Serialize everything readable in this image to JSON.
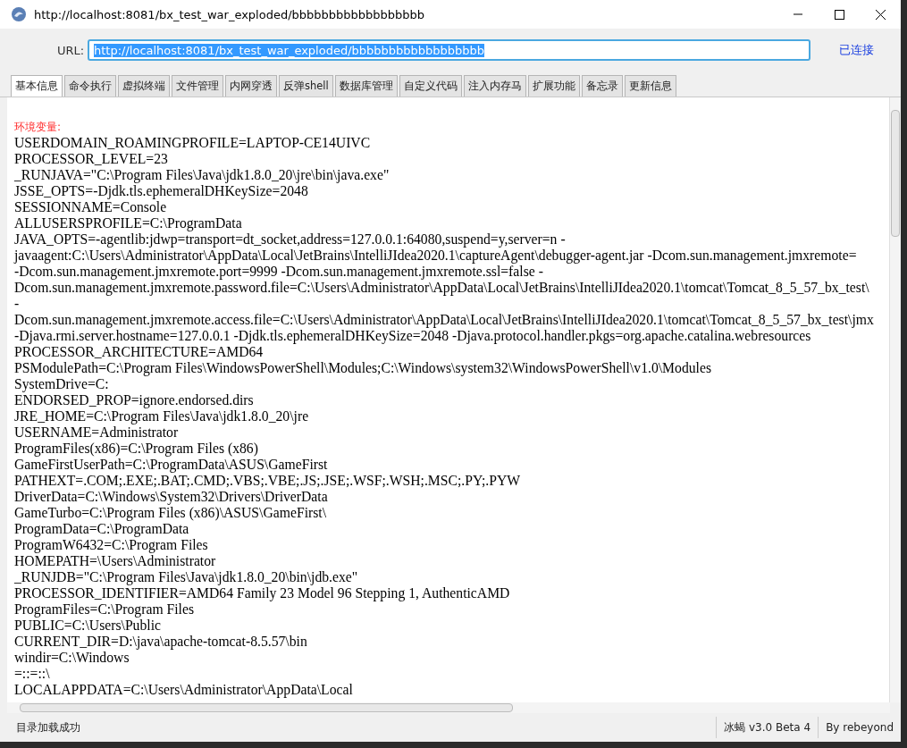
{
  "window": {
    "title": "http://localhost:8081/bx_test_war_exploded/bbbbbbbbbbbbbbbbbb"
  },
  "url_bar": {
    "label": "URL:",
    "value": "http://localhost:8081/bx_test_war_exploded/bbbbbbbbbbbbbbbbbb",
    "text_selected": true,
    "status": "已连接"
  },
  "tabs": [
    {
      "label": "基本信息",
      "selected": true
    },
    {
      "label": "命令执行",
      "selected": false
    },
    {
      "label": "虚拟终端",
      "selected": false
    },
    {
      "label": "文件管理",
      "selected": false
    },
    {
      "label": "内网穿透",
      "selected": false
    },
    {
      "label": "反弹shell",
      "selected": false
    },
    {
      "label": "数据库管理",
      "selected": false
    },
    {
      "label": "自定义代码",
      "selected": false
    },
    {
      "label": "注入内存马",
      "selected": false
    },
    {
      "label": "扩展功能",
      "selected": false
    },
    {
      "label": "备忘录",
      "selected": false
    },
    {
      "label": "更新信息",
      "selected": false
    }
  ],
  "content": {
    "heading": "环境变量:",
    "lines": [
      "USERDOMAIN_ROAMINGPROFILE=LAPTOP-CE14UIVC",
      "PROCESSOR_LEVEL=23",
      "_RUNJAVA=\"C:\\Program Files\\Java\\jdk1.8.0_20\\jre\\bin\\java.exe\"",
      "JSSE_OPTS=-Djdk.tls.ephemeralDHKeySize=2048",
      "SESSIONNAME=Console",
      "ALLUSERSPROFILE=C:\\ProgramData",
      "JAVA_OPTS=-agentlib:jdwp=transport=dt_socket,address=127.0.0.1:64080,suspend=y,server=n -",
      "javaagent:C:\\Users\\Administrator\\AppData\\Local\\JetBrains\\IntelliJIdea2020.1\\captureAgent\\debugger-agent.jar -Dcom.sun.management.jmxremote=",
      "-Dcom.sun.management.jmxremote.port=9999 -Dcom.sun.management.jmxremote.ssl=false -",
      "Dcom.sun.management.jmxremote.password.file=C:\\Users\\Administrator\\AppData\\Local\\JetBrains\\IntelliJIdea2020.1\\tomcat\\Tomcat_8_5_57_bx_test\\",
      "-",
      "Dcom.sun.management.jmxremote.access.file=C:\\Users\\Administrator\\AppData\\Local\\JetBrains\\IntelliJIdea2020.1\\tomcat\\Tomcat_8_5_57_bx_test\\jmx",
      "-Djava.rmi.server.hostname=127.0.0.1 -Djdk.tls.ephemeralDHKeySize=2048 -Djava.protocol.handler.pkgs=org.apache.catalina.webresources",
      "PROCESSOR_ARCHITECTURE=AMD64",
      "PSModulePath=C:\\Program Files\\WindowsPowerShell\\Modules;C:\\Windows\\system32\\WindowsPowerShell\\v1.0\\Modules",
      "SystemDrive=C:",
      "ENDORSED_PROP=ignore.endorsed.dirs",
      "JRE_HOME=C:\\Program Files\\Java\\jdk1.8.0_20\\jre",
      "USERNAME=Administrator",
      "ProgramFiles(x86)=C:\\Program Files (x86)",
      "GameFirstUserPath=C:\\ProgramData\\ASUS\\GameFirst",
      "PATHEXT=.COM;.EXE;.BAT;.CMD;.VBS;.VBE;.JS;.JSE;.WSF;.WSH;.MSC;.PY;.PYW",
      "DriverData=C:\\Windows\\System32\\Drivers\\DriverData",
      "GameTurbo=C:\\Program Files (x86)\\ASUS\\GameFirst\\",
      "ProgramData=C:\\ProgramData",
      "ProgramW6432=C:\\Program Files",
      "HOMEPATH=\\Users\\Administrator",
      "_RUNJDB=\"C:\\Program Files\\Java\\jdk1.8.0_20\\bin\\jdb.exe\"",
      "PROCESSOR_IDENTIFIER=AMD64 Family 23 Model 96 Stepping 1, AuthenticAMD",
      "ProgramFiles=C:\\Program Files",
      "PUBLIC=C:\\Users\\Public",
      "CURRENT_DIR=D:\\java\\apache-tomcat-8.5.57\\bin",
      "windir=C:\\Windows",
      "=::=::\\",
      "LOCALAPPDATA=C:\\Users\\Administrator\\AppData\\Local"
    ]
  },
  "status_bar": {
    "message": "目录加载成功",
    "version": "冰蝎 v3.0 Beta 4",
    "author": "By rebeyond"
  }
}
